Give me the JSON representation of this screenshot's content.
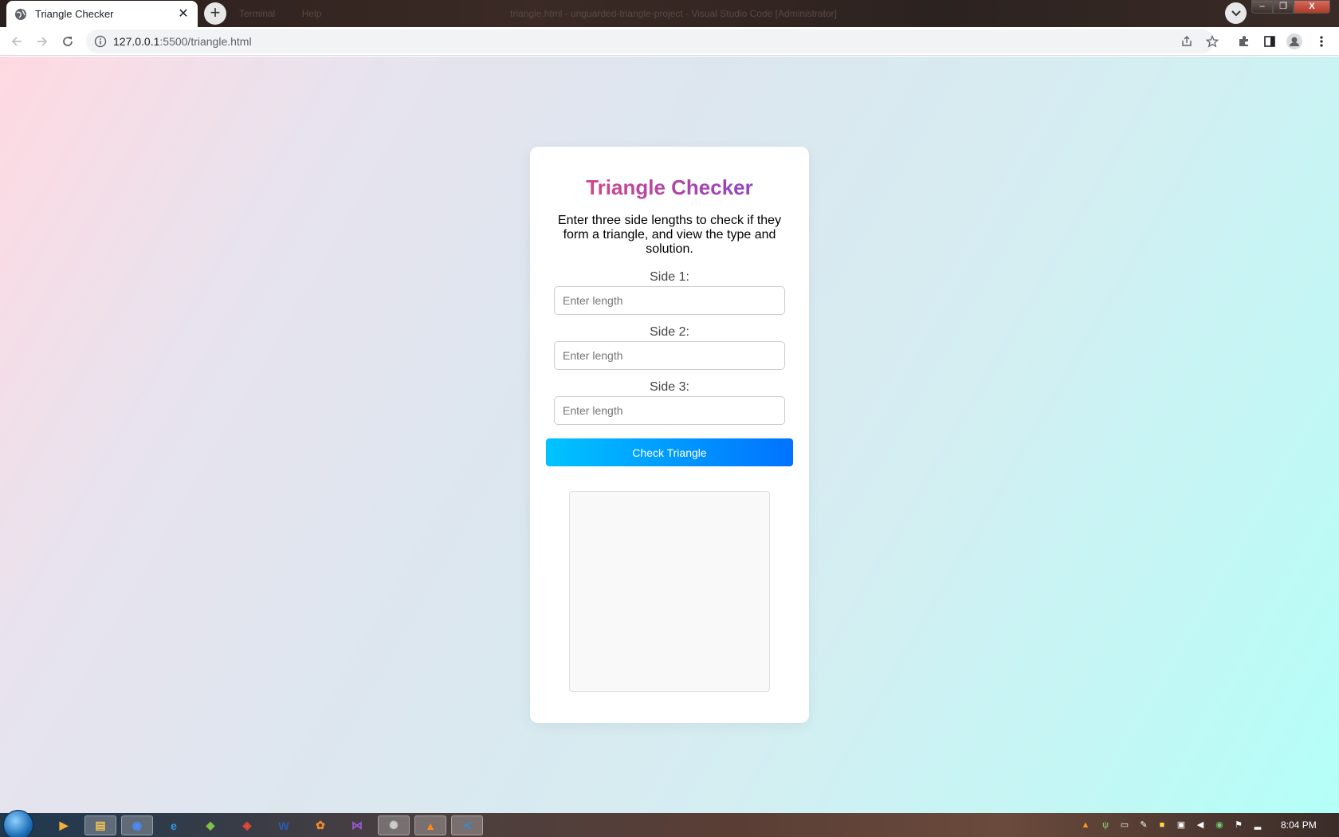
{
  "browser": {
    "tab_title": "Triangle Checker",
    "tab_close": "✕",
    "new_tab": "+",
    "ghost_tabs": [
      "Terminal",
      "Help"
    ],
    "ghost_title": "triangle.html - unguarded-triangle-project - Visual Studio Code [Administrator]",
    "url_host": "127.0.0.1",
    "url_path": ":5500/triangle.html",
    "window_controls": {
      "minimize": "–",
      "maximize": "❐",
      "close": "X"
    }
  },
  "page": {
    "title": "Triangle Checker",
    "description": "Enter three side lengths to check if they form a triangle, and view the type and solution.",
    "sides": [
      {
        "label": "Side 1:",
        "placeholder": "Enter length",
        "value": ""
      },
      {
        "label": "Side 2:",
        "placeholder": "Enter length",
        "value": ""
      },
      {
        "label": "Side 3:",
        "placeholder": "Enter length",
        "value": ""
      }
    ],
    "button_label": "Check Triangle",
    "result": "",
    "colors": {
      "title_gradient": [
        "#e8487a",
        "#7a44d0"
      ],
      "button_gradient": [
        "#00c4ff",
        "#0072ff"
      ],
      "background_gradient": [
        "#ffd9e2",
        "#b4fff8"
      ]
    }
  },
  "taskbar": {
    "apps": [
      {
        "name": "media-player-icon",
        "glyph": "▶"
      },
      {
        "name": "file-explorer-icon",
        "glyph": "▤"
      },
      {
        "name": "chrome-icon",
        "glyph": "◉"
      },
      {
        "name": "internet-explorer-icon",
        "glyph": "e"
      },
      {
        "name": "android-studio-icon",
        "glyph": "◆"
      },
      {
        "name": "anydesk-icon",
        "glyph": "◈"
      },
      {
        "name": "word-icon",
        "glyph": "W"
      },
      {
        "name": "blender-icon",
        "glyph": "✿"
      },
      {
        "name": "visual-studio-icon",
        "glyph": "⋈"
      },
      {
        "name": "openai-icon",
        "glyph": "✺"
      },
      {
        "name": "vlc-icon",
        "glyph": "▲"
      },
      {
        "name": "vscode-icon",
        "glyph": "≺"
      }
    ],
    "clock": "8:04 PM"
  }
}
